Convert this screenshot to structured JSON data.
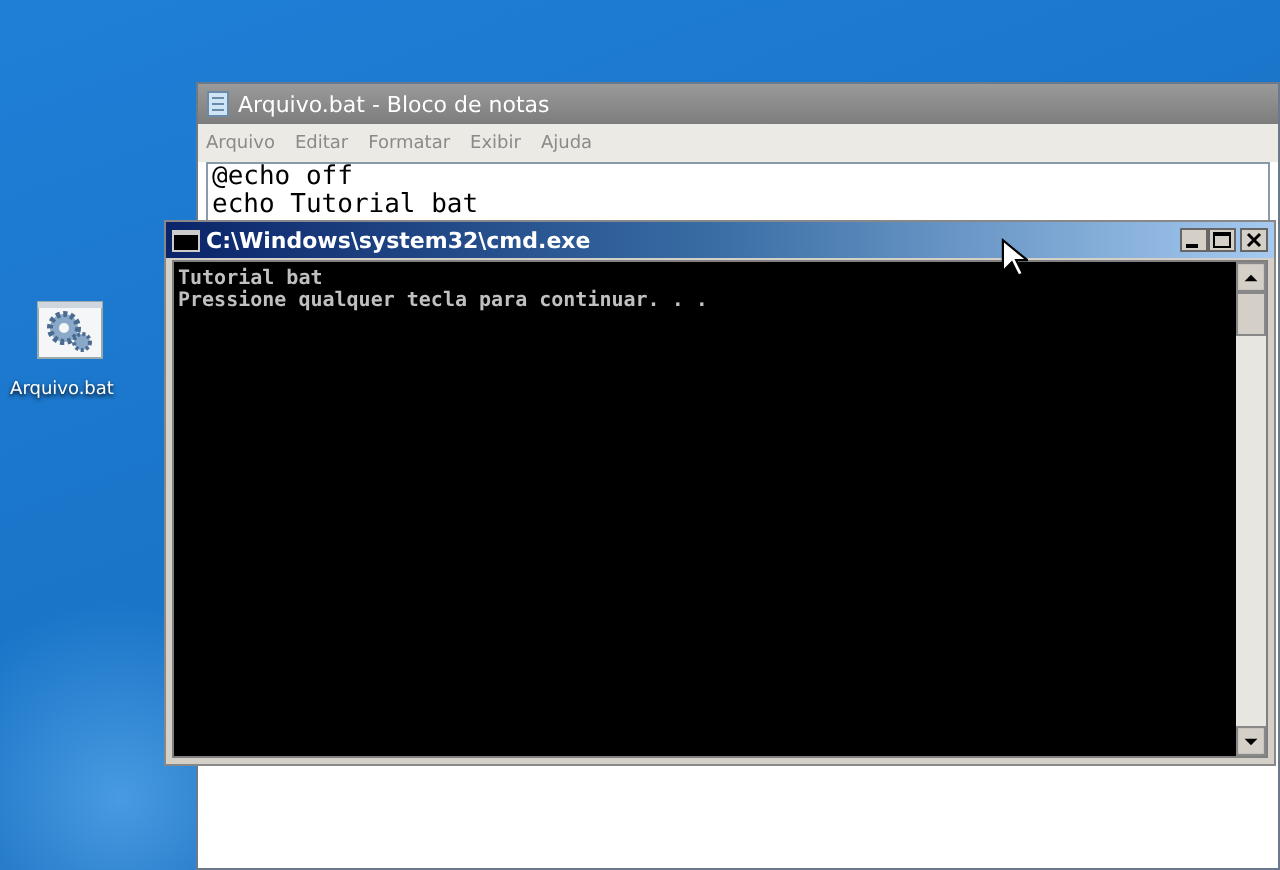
{
  "desktop": {
    "icons": [
      {
        "label": "Arquivo.bat"
      }
    ]
  },
  "notepad": {
    "title": "Arquivo.bat - Bloco de notas",
    "menu": [
      "Arquivo",
      "Editar",
      "Formatar",
      "Exibir",
      "Ajuda"
    ],
    "lines": [
      "@echo off",
      "echo Tutorial bat"
    ]
  },
  "console": {
    "title": "C:\\Windows\\system32\\cmd.exe",
    "lines": [
      "Tutorial bat",
      "Pressione qualquer tecla para continuar. . ."
    ]
  }
}
